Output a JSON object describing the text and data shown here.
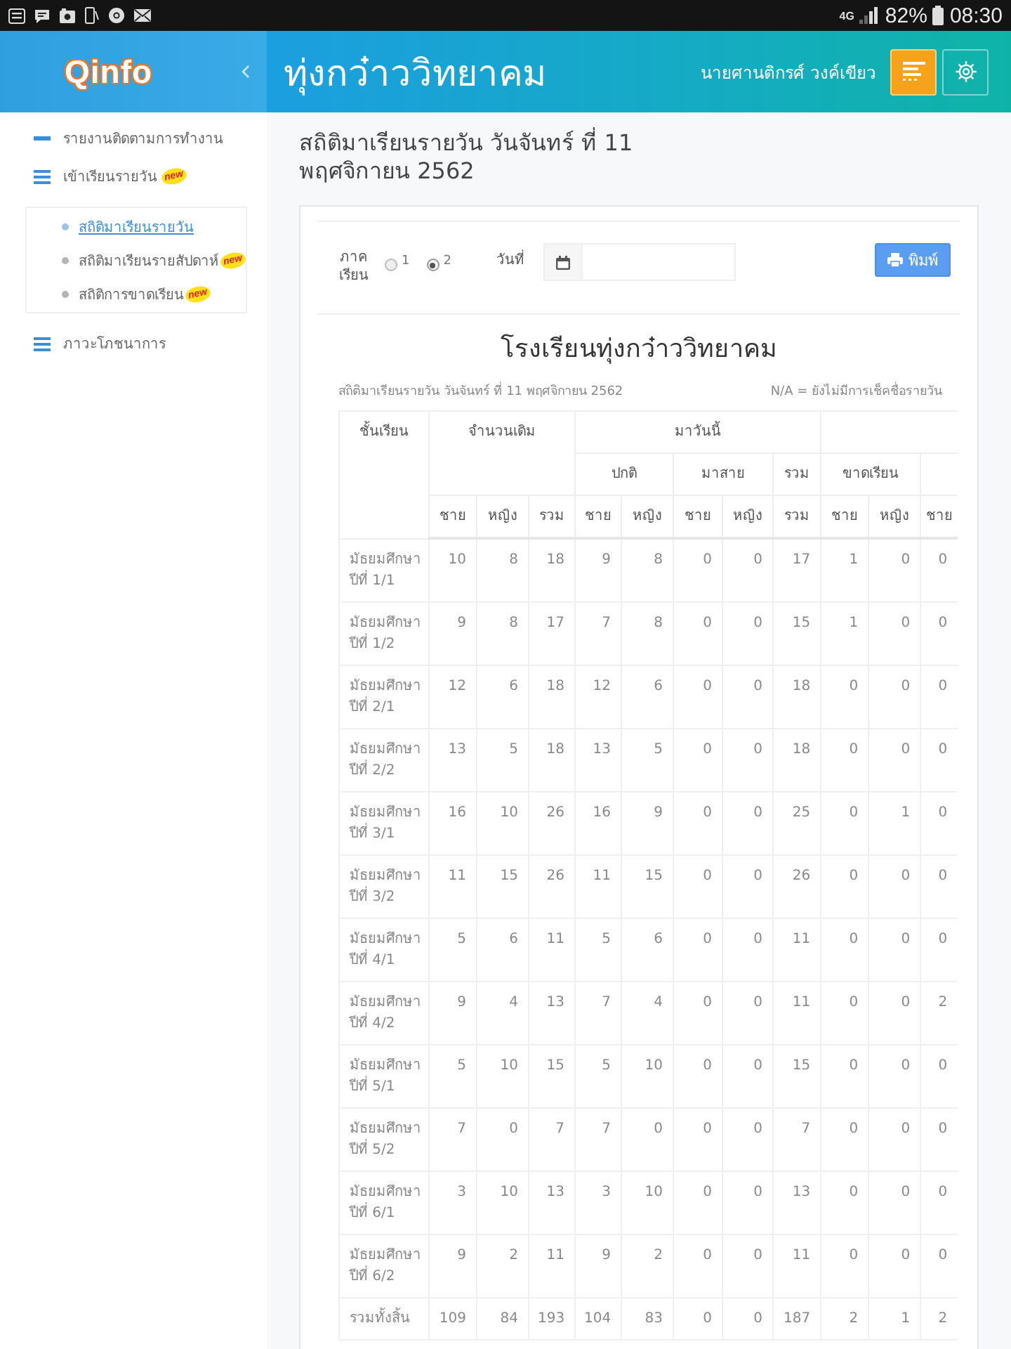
{
  "status_bar": {
    "network": "4G",
    "battery": "82%",
    "time": "08:30"
  },
  "header": {
    "logo": "Qinfo",
    "title": "ทุ่งกว๋าววิทยาคม",
    "user": "นายศานติกรศ์ วงค์เขียว"
  },
  "sidebar": {
    "items": [
      {
        "kind": "link",
        "label": "รายงานติดตามการทำงาน"
      },
      {
        "kind": "group",
        "label": "เข้าเรียนรายวัน",
        "badge": "new",
        "children": [
          {
            "label": "สถิติมาเรียนรายวัน",
            "selected": true
          },
          {
            "label": "สถิติมาเรียนรายสัปดาห์",
            "selected": false,
            "badge": "new"
          },
          {
            "label": "สถิติการขาดเรียน",
            "selected": false,
            "badge": "new"
          }
        ]
      },
      {
        "kind": "group",
        "label": "ภาวะโภชนาการ"
      }
    ]
  },
  "page": {
    "heading": "สถิติมาเรียนรายวัน วันจันทร์ ที่ 11 พฤศจิกายน 2562",
    "filters": {
      "semester_label": "ภาคเรียน",
      "semesters": [
        {
          "label": "1",
          "selected": false
        },
        {
          "label": "2",
          "selected": true
        }
      ],
      "date_label": "วันที่",
      "print_button": "พิมพ์"
    },
    "report": {
      "title": "โรงเรียนทุ่งกว๋าววิทยาคม",
      "caption": "สถิติมาเรียนรายวัน วันจันทร์ ที่ 11 พฤศจิกายน 2562",
      "note": "N/A = ยังไม่มีการเช็คชื่อรายวัน",
      "columns": [
        {
          "label": "ชั้นเรียน"
        },
        {
          "label": "จำนวนเดิม",
          "children": [
            {
              "label": "ชาย"
            },
            {
              "label": "หญิง"
            },
            {
              "label": "รวม"
            }
          ]
        },
        {
          "label": "มาวันนี้",
          "children": [
            {
              "label": "ปกติ",
              "children": [
                {
                  "label": "ชาย"
                },
                {
                  "label": "หญิง"
                }
              ]
            },
            {
              "label": "มาสาย",
              "children": [
                {
                  "label": "ชาย"
                },
                {
                  "label": "หญิง"
                }
              ]
            },
            {
              "label": "รวม",
              "children": [
                {
                  "label": "รวม"
                }
              ]
            }
          ]
        },
        {
          "children": [
            {
              "label": "ขาดเรียน",
              "children": [
                {
                  "label": "ชาย"
                },
                {
                  "label": "หญิง"
                }
              ]
            },
            {
              "children": [
                {
                  "label": "ชาย"
                }
              ]
            }
          ]
        }
      ],
      "rows": [
        {
          "class": "มัธยมศึกษา ปีที่ 1/1",
          "values": [
            "10",
            "8",
            "18",
            "9",
            "8",
            "0",
            "0",
            "17",
            "1",
            "0",
            "0"
          ]
        },
        {
          "class": "มัธยมศึกษา ปีที่ 1/2",
          "values": [
            "9",
            "8",
            "17",
            "7",
            "8",
            "0",
            "0",
            "15",
            "1",
            "0",
            "0"
          ]
        },
        {
          "class": "มัธยมศึกษา ปีที่ 2/1",
          "values": [
            "12",
            "6",
            "18",
            "12",
            "6",
            "0",
            "0",
            "18",
            "0",
            "0",
            "0"
          ]
        },
        {
          "class": "มัธยมศึกษา ปีที่ 2/2",
          "values": [
            "13",
            "5",
            "18",
            "13",
            "5",
            "0",
            "0",
            "18",
            "0",
            "0",
            "0"
          ]
        },
        {
          "class": "มัธยมศึกษา ปีที่ 3/1",
          "values": [
            "16",
            "10",
            "26",
            "16",
            "9",
            "0",
            "0",
            "25",
            "0",
            "1",
            "0"
          ]
        },
        {
          "class": "มัธยมศึกษา ปีที่ 3/2",
          "values": [
            "11",
            "15",
            "26",
            "11",
            "15",
            "0",
            "0",
            "26",
            "0",
            "0",
            "0"
          ]
        },
        {
          "class": "มัธยมศึกษา ปีที่ 4/1",
          "values": [
            "5",
            "6",
            "11",
            "5",
            "6",
            "0",
            "0",
            "11",
            "0",
            "0",
            "0"
          ]
        },
        {
          "class": "มัธยมศึกษา ปีที่ 4/2",
          "values": [
            "9",
            "4",
            "13",
            "7",
            "4",
            "0",
            "0",
            "11",
            "0",
            "0",
            "2"
          ]
        },
        {
          "class": "มัธยมศึกษา ปีที่ 5/1",
          "values": [
            "5",
            "10",
            "15",
            "5",
            "10",
            "0",
            "0",
            "15",
            "0",
            "0",
            "0"
          ]
        },
        {
          "class": "มัธยมศึกษา ปีที่ 5/2",
          "values": [
            "7",
            "0",
            "7",
            "7",
            "0",
            "0",
            "0",
            "7",
            "0",
            "0",
            "0"
          ]
        },
        {
          "class": "มัธยมศึกษา ปีที่ 6/1",
          "values": [
            "3",
            "10",
            "13",
            "3",
            "10",
            "0",
            "0",
            "13",
            "0",
            "0",
            "0"
          ]
        },
        {
          "class": "มัธยมศึกษา ปีที่ 6/2",
          "values": [
            "9",
            "2",
            "11",
            "9",
            "2",
            "0",
            "0",
            "11",
            "0",
            "0",
            "0"
          ]
        },
        {
          "class": "รวมทั้งสิ้น",
          "values": [
            "109",
            "84",
            "193",
            "104",
            "83",
            "0",
            "0",
            "187",
            "2",
            "1",
            "2"
          ]
        }
      ]
    }
  }
}
